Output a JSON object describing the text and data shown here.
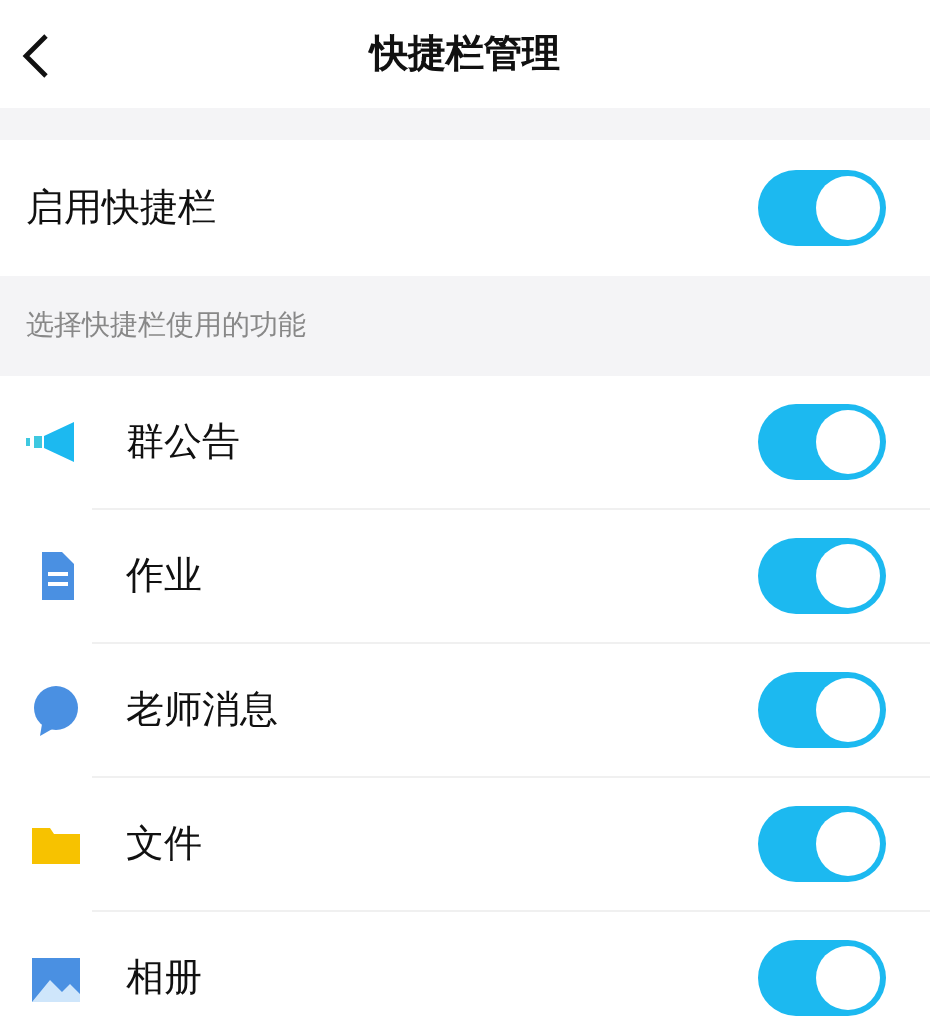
{
  "header": {
    "title": "快捷栏管理"
  },
  "master": {
    "label": "启用快捷栏",
    "on": true
  },
  "section_label": "选择快捷栏使用的功能",
  "features": [
    {
      "kind": "megaphone",
      "label": "群公告",
      "on": true
    },
    {
      "kind": "document",
      "label": "作业",
      "on": true
    },
    {
      "kind": "chat",
      "label": "老师消息",
      "on": true
    },
    {
      "kind": "folder",
      "label": "文件",
      "on": true
    },
    {
      "kind": "image",
      "label": "相册",
      "on": true
    }
  ]
}
